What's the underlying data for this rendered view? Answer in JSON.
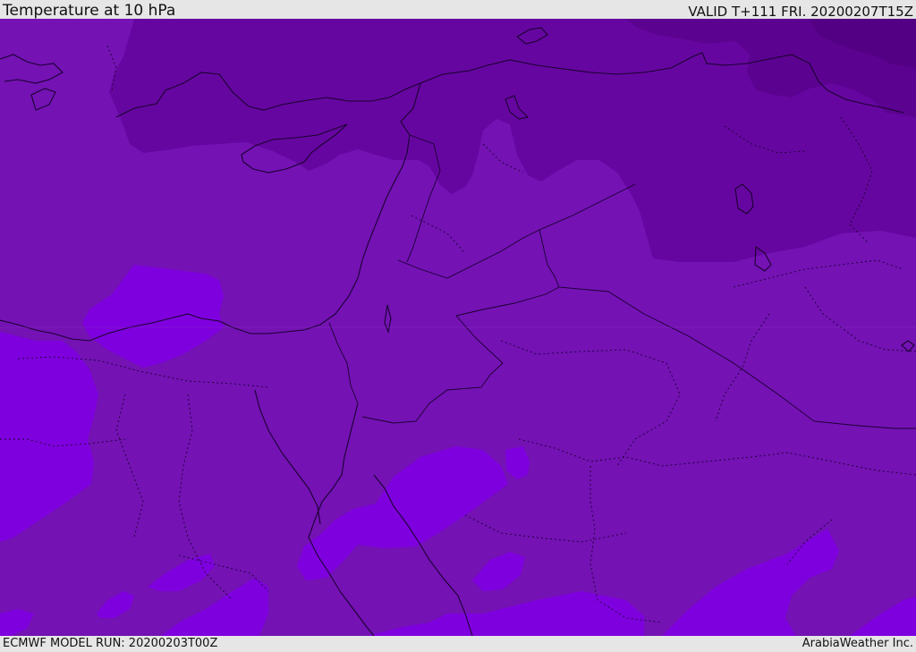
{
  "header": {
    "title": "Temperature at 10 hPa",
    "valid": "VALID T+111 FRI. 20200207T15Z"
  },
  "footer": {
    "model_run": "ECMWF MODEL RUN: 20200203T00Z",
    "credit": "ArabiaWeather Inc."
  },
  "colors": {
    "base": "#7412b4",
    "dark": "#6606a0",
    "darker": "#5c0290",
    "darkest": "#540084",
    "light": "#7f00de",
    "lighter": "#8600e6",
    "coastline": "#1a0030"
  },
  "map": {
    "region": "Eastern Mediterranean, Egypt, Levant, Northern Arabia",
    "field": "temperature-10hPa"
  }
}
